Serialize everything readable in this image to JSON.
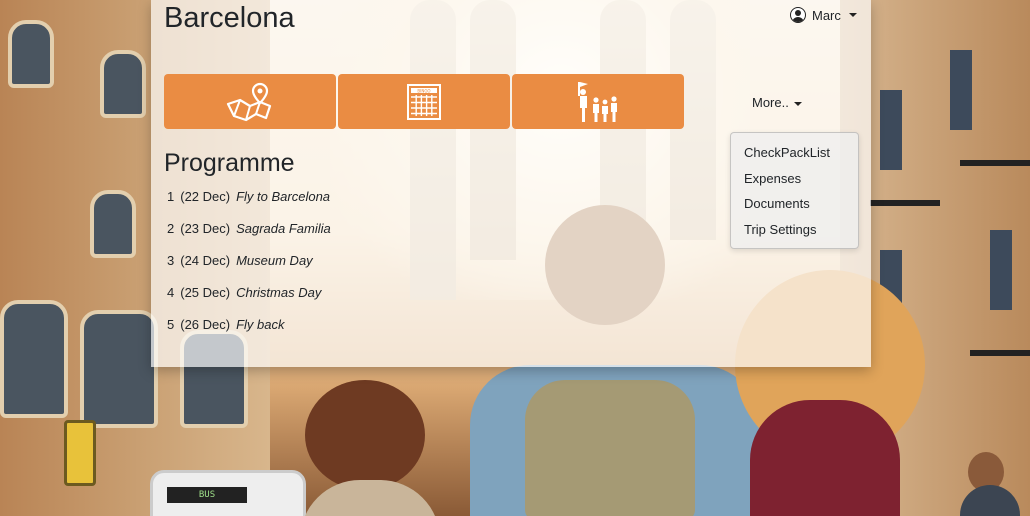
{
  "app": {
    "title": "Barcelona"
  },
  "user": {
    "name": "Marc",
    "icon": "user-avatar-icon"
  },
  "toolbar": {
    "buttons": [
      {
        "icon": "map-pin-icon"
      },
      {
        "icon": "bingo-card-icon"
      },
      {
        "icon": "group-guide-icon",
        "icon_text": "BINGO"
      }
    ]
  },
  "more_menu": {
    "label": "More..",
    "items": [
      "CheckPackList",
      "Expenses",
      "Documents",
      "Trip Settings"
    ]
  },
  "programme": {
    "heading": "Programme",
    "days": [
      {
        "num": "1",
        "date": "(22 Dec)",
        "name": "Fly to Barcelona"
      },
      {
        "num": "2",
        "date": "(23 Dec)",
        "name": "Sagrada Familia"
      },
      {
        "num": "3",
        "date": "(24 Dec)",
        "name": "Museum Day"
      },
      {
        "num": "4",
        "date": "(25 Dec)",
        "name": "Christmas Day"
      },
      {
        "num": "5",
        "date": "(26 Dec)",
        "name": "Fly back"
      }
    ]
  },
  "background": {
    "bus_sign": "BUS"
  },
  "colors": {
    "accent": "#ea8c43",
    "panel": "rgba(255,255,255,0.68)"
  }
}
